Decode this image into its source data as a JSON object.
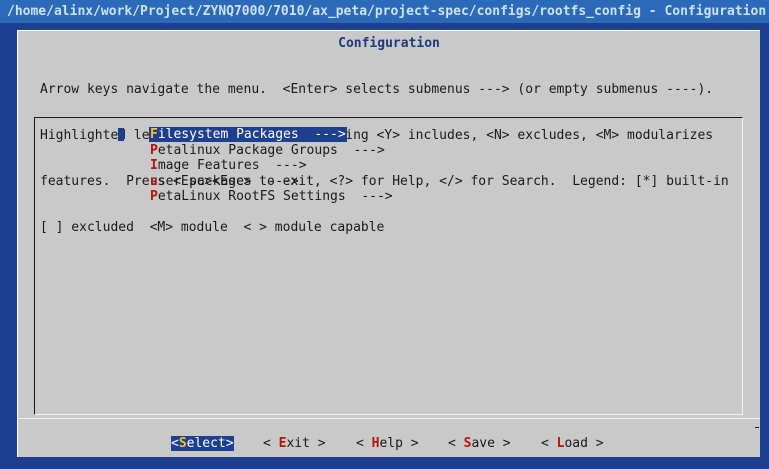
{
  "window": {
    "title": "/home/alinx/work/Project/ZYNQ7000/7010/ax_peta/project-spec/configs/rootfs_config - Configuration"
  },
  "dialog": {
    "title": "Configuration",
    "help_lines": [
      "Arrow keys navigate the menu.  <Enter> selects submenus ---> (or empty submenus ----).",
      "Highlighted letters are hotkeys.  Pressing <Y> includes, <N> excludes, <M> modularizes",
      "features.  Press <Esc><Esc> to exit, <?> for Help, </> for Search.  Legend: [*] built-in",
      "[ ] excluded  <M> module  < > module capable"
    ]
  },
  "menu": {
    "items": [
      {
        "hotkey": "F",
        "label": "ilesystem Packages",
        "arrow": "  --->",
        "selected": true
      },
      {
        "hotkey": "P",
        "label": "etalinux Package Groups",
        "arrow": "  --->",
        "selected": false
      },
      {
        "hotkey": "I",
        "label": "mage Features",
        "arrow": "  --->",
        "selected": false
      },
      {
        "hotkey": "u",
        "label": "ser packages",
        "arrow": "  --->",
        "selected": false
      },
      {
        "hotkey": "P",
        "label": "etaLinux RootFS Settings",
        "arrow": "  --->",
        "selected": false
      }
    ]
  },
  "buttons": {
    "select": {
      "open": "<",
      "hotkey": "S",
      "rest": "elect",
      "close": ">"
    },
    "exit": {
      "open": "< ",
      "hotkey": "E",
      "rest": "xit",
      "close": " >"
    },
    "help": {
      "open": "< ",
      "hotkey": "H",
      "rest": "elp",
      "close": " >"
    },
    "save": {
      "open": "< ",
      "hotkey": "S",
      "rest": "ave",
      "close": " >"
    },
    "load": {
      "open": "< ",
      "hotkey": "L",
      "rest": "oad",
      "close": " >"
    }
  },
  "colors": {
    "background": "#1d3f8f",
    "title_bar": "#2b6ab8",
    "dialog": "#c9c9c9",
    "selection": "#1d3f8f",
    "hotkey": "#b4140a",
    "selected_hotkey": "#ffc22b"
  }
}
